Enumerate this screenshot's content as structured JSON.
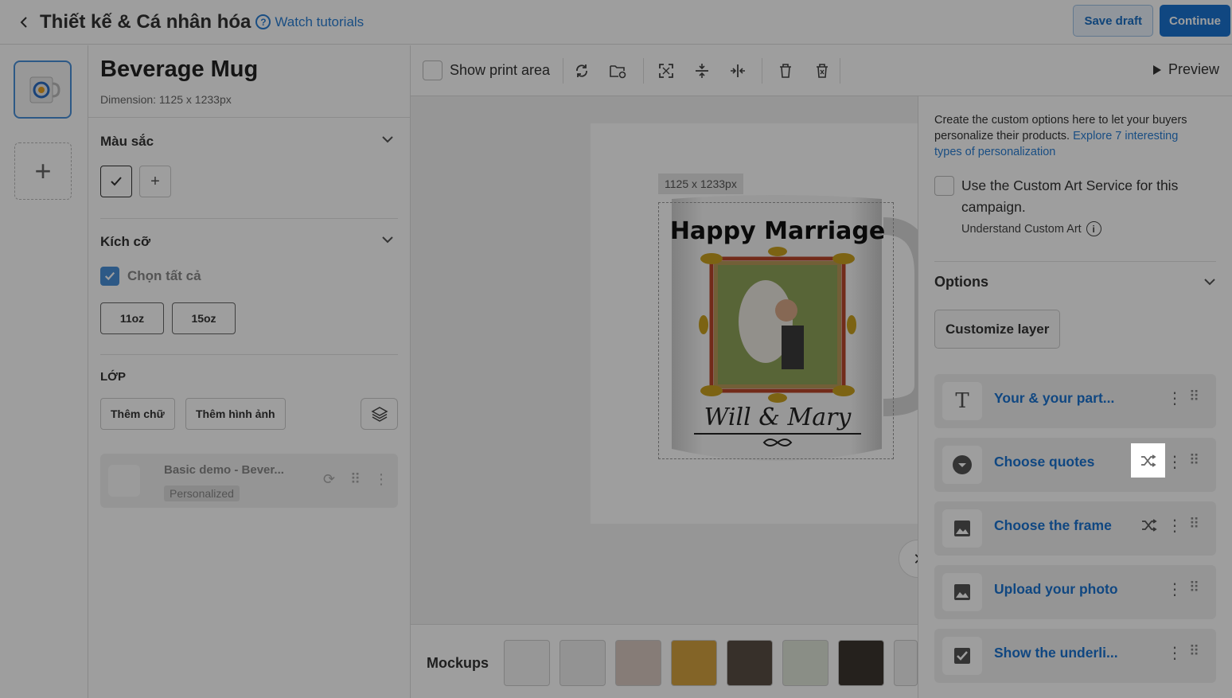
{
  "header": {
    "title": "Thiết kế & Cá nhân hóa",
    "tutorial_label": "Watch tutorials",
    "save_draft_label": "Save draft",
    "continue_label": "Continue"
  },
  "product": {
    "name": "Beverage Mug",
    "dimension": "Dimension: 1125 x 1233px"
  },
  "color_section": {
    "title": "Màu sắc"
  },
  "size_section": {
    "title": "Kích cỡ",
    "select_all_label": "Chọn tất cả",
    "sizes": [
      "11oz",
      "15oz"
    ]
  },
  "layer_section": {
    "title": "LỚP",
    "add_text_label": "Thêm chữ",
    "add_image_label": "Thêm hình ảnh",
    "layer_name": "Basic demo - Bever...",
    "layer_badge": "Personalized"
  },
  "toolbar": {
    "show_print_area_label": "Show print area",
    "preview_label": "Preview"
  },
  "canvas": {
    "dimension_tag": "1125 x 1233px",
    "mug_text_top": "Happy Marriage",
    "mug_text_bottom": "Will & Mary"
  },
  "mockups": {
    "label": "Mockups"
  },
  "options_panel": {
    "intro_text": "Create the custom options here to let your buyers personalize their products.",
    "intro_link": "Explore 7 interesting types of personalization",
    "custom_art_text": "Use the Custom Art Service for this campaign.",
    "custom_art_sub": "Understand Custom Art",
    "options_title": "Options",
    "customize_layer_label": "Customize layer",
    "items": [
      {
        "label": "Your & your part...",
        "icon": "text-icon"
      },
      {
        "label": "Choose quotes",
        "icon": "dropdown-icon"
      },
      {
        "label": "Choose the frame",
        "icon": "image-icon"
      },
      {
        "label": "Upload your photo",
        "icon": "image-icon"
      },
      {
        "label": "Show the underli...",
        "icon": "checkbox-icon"
      }
    ]
  },
  "colors": {
    "accent": "#1a73d1",
    "link": "#2a7fd4"
  }
}
